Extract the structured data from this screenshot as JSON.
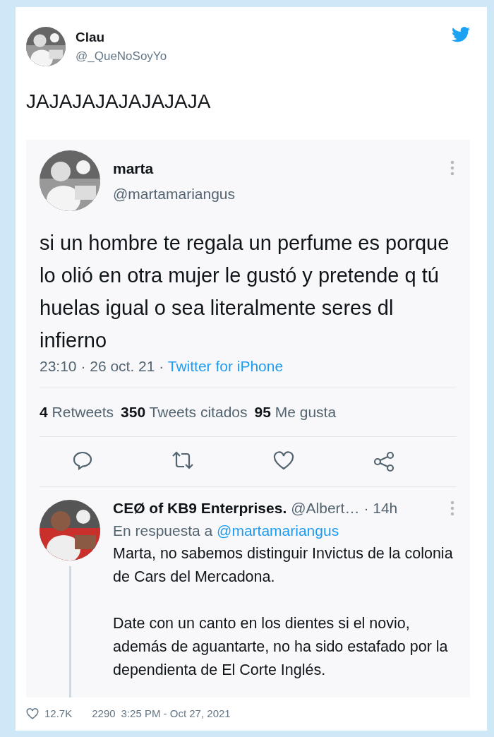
{
  "author": {
    "name": "Clau",
    "handle": "@_QueNoSoyYo"
  },
  "text": "JAJAJAJAJAJAJAJA",
  "quoted": {
    "name": "marta",
    "handle": "@martamariangus",
    "text": "si un hombre te regala un perfume es porque lo olió en otra mujer le gustó y pretende q tú huelas igual o sea literalmente seres dl infierno",
    "time": "23:10 · 26 oct. 21 ·",
    "source": "Twitter for iPhone",
    "stats": [
      {
        "count": "4",
        "label": "Retweets"
      },
      {
        "count": "350",
        "label": "Tweets citados"
      },
      {
        "count": "95",
        "label": "Me gusta"
      }
    ]
  },
  "reply": {
    "name": "CEØ of KB9 Enterprises.",
    "handle": "@Albert…",
    "time": "· 14h",
    "reply_label": "En respuesta a",
    "reply_to": "@martamariangus",
    "paragraphs": [
      "Marta, no sabemos distinguir Invictus de la colonia de Cars del Mercadona.",
      "Date con un canto en los dientes si el novio, además de aguantarte, no ha sido estafado por la dependienta de El Corte Inglés."
    ]
  },
  "footer": {
    "likes": "12.7K",
    "count": "2290",
    "timestamp": "3:25 PM - Oct 27, 2021"
  }
}
